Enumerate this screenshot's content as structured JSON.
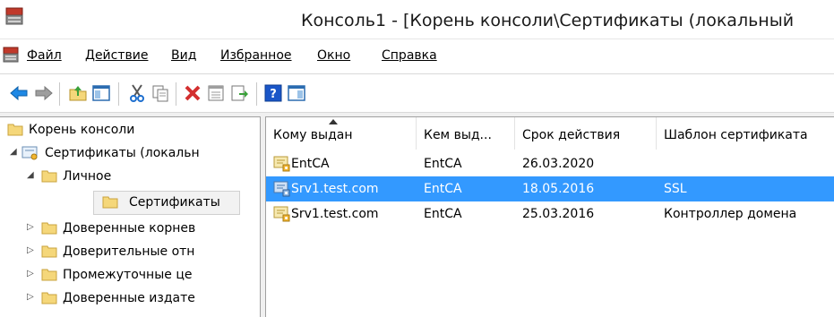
{
  "window": {
    "title": "Консоль1 - [Корень консоли\\Сертификаты (локальный"
  },
  "menu": {
    "items": [
      {
        "label": "Файл"
      },
      {
        "label": "Действие"
      },
      {
        "label": "Вид"
      },
      {
        "label": "Избранное"
      },
      {
        "label": "Окно"
      },
      {
        "label": "Справка"
      }
    ]
  },
  "toolbar": {
    "buttons": [
      "back-icon",
      "forward-icon",
      "up-folder-icon",
      "show-hide-tree-icon",
      "cut-icon",
      "copy-icon",
      "delete-icon",
      "properties-icon",
      "export-icon",
      "help-icon",
      "show-action-pane-icon"
    ]
  },
  "tree": {
    "items": [
      {
        "label": "Корень консоли",
        "level": 0
      },
      {
        "label": "Сертификаты (локальн",
        "level": 1,
        "expanded": true
      },
      {
        "label": "Личное",
        "level": 2,
        "expanded": true
      },
      {
        "label": "Сертификаты",
        "level": 3,
        "selected": true
      },
      {
        "label": "Доверенные корнев",
        "level": 2
      },
      {
        "label": "Доверительные отн",
        "level": 2
      },
      {
        "label": "Промежуточные це",
        "level": 2
      },
      {
        "label": "Доверенные издате",
        "level": 2
      }
    ]
  },
  "list": {
    "columns": [
      "Кому выдан",
      "Кем выд...",
      "Срок действия",
      "Шаблон сертификата"
    ],
    "rows": [
      {
        "issued_to": "EntCA",
        "issued_by": "EntCA",
        "expires": "26.03.2020",
        "template": "",
        "selected": false
      },
      {
        "issued_to": "Srv1.test.com",
        "issued_by": "EntCA",
        "expires": "18.05.2016",
        "template": "SSL",
        "selected": true
      },
      {
        "issued_to": "Srv1.test.com",
        "issued_by": "EntCA",
        "expires": "25.03.2016",
        "template": "Контроллер домена",
        "selected": false
      }
    ]
  },
  "colors": {
    "selection": "#3399ff",
    "folder": "#f5d77a"
  }
}
